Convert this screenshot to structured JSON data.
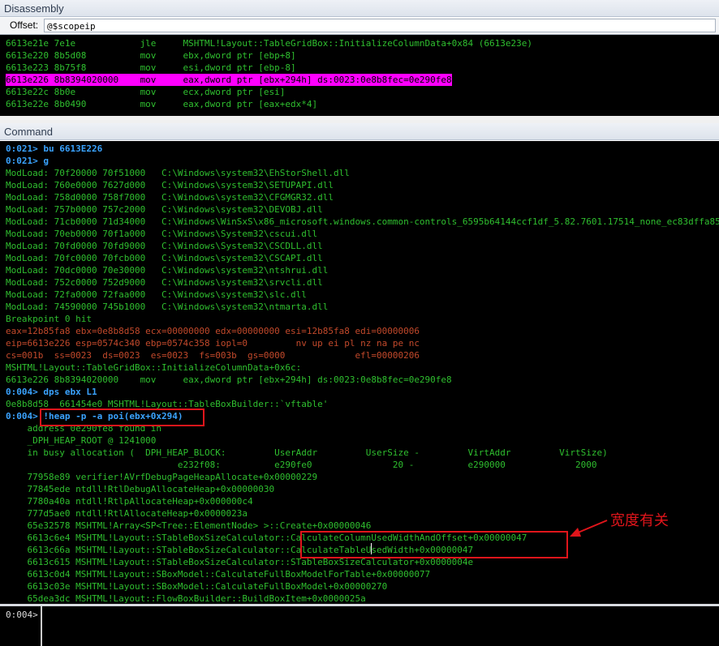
{
  "disassembly": {
    "title": "Disassembly",
    "offset_label": "Offset:",
    "offset_value": "@$scopeip",
    "lines": [
      "6613e21e 7e1e            jle     MSHTML!Layout::TableGridBox::InitializeColumnData+0x84 (6613e23e)",
      "6613e220 8b5d08          mov     ebx,dword ptr [ebp+8]",
      "6613e223 8b75f8          mov     esi,dword ptr [ebp-8]",
      "6613e226 8b8394020000    mov     eax,dword ptr [ebx+294h] ds:0023:0e8b8fec=0e290fe8",
      "6613e22c 8b0e            mov     ecx,dword ptr [esi]",
      "6613e22e 8b0490          mov     eax,dword ptr [eax+edx*4]"
    ],
    "highlighted_index": 3
  },
  "command": {
    "title": "Command",
    "lines": [
      {
        "t": "0:021> bu 6613E226",
        "c": "prompt"
      },
      {
        "t": "0:021> g",
        "c": "prompt"
      },
      {
        "t": "ModLoad: 70f20000 70f51000   C:\\Windows\\system32\\EhStorShell.dll",
        "c": "txt"
      },
      {
        "t": "ModLoad: 760e0000 7627d000   C:\\Windows\\system32\\SETUPAPI.dll",
        "c": "txt"
      },
      {
        "t": "ModLoad: 758d0000 758f7000   C:\\Windows\\system32\\CFGMGR32.dll",
        "c": "txt"
      },
      {
        "t": "ModLoad: 757b0000 757c2000   C:\\Windows\\system32\\DEVOBJ.dll",
        "c": "txt"
      },
      {
        "t": "ModLoad: 71cb0000 71d34000   C:\\Windows\\WinSxS\\x86_microsoft.windows.common-controls_6595b64144ccf1df_5.82.7601.17514_none_ec83dffa859149af",
        "c": "txt"
      },
      {
        "t": "ModLoad: 70eb0000 70f1a000   C:\\Windows\\System32\\cscui.dll",
        "c": "txt"
      },
      {
        "t": "ModLoad: 70fd0000 70fd9000   C:\\Windows\\System32\\CSCDLL.dll",
        "c": "txt"
      },
      {
        "t": "ModLoad: 70fc0000 70fcb000   C:\\Windows\\system32\\CSCAPI.dll",
        "c": "txt"
      },
      {
        "t": "ModLoad: 70dc0000 70e30000   C:\\Windows\\system32\\ntshrui.dll",
        "c": "txt"
      },
      {
        "t": "ModLoad: 752c0000 752d9000   C:\\Windows\\system32\\srvcli.dll",
        "c": "txt"
      },
      {
        "t": "ModLoad: 72fa0000 72faa000   C:\\Windows\\system32\\slc.dll",
        "c": "txt"
      },
      {
        "t": "ModLoad: 74590000 745b1000   C:\\Windows\\system32\\ntmarta.dll",
        "c": "txt"
      },
      {
        "t": "Breakpoint 0 hit",
        "c": "txt"
      },
      {
        "t": "eax=12b85fa8 ebx=0e8b8d58 ecx=00000000 edx=00000000 esi=12b85fa8 edi=00000006",
        "c": "err"
      },
      {
        "t": "eip=6613e226 esp=0574c340 ebp=0574c358 iopl=0         nv up ei pl nz na pe nc",
        "c": "err"
      },
      {
        "t": "cs=001b  ss=0023  ds=0023  es=0023  fs=003b  gs=0000             efl=00000206",
        "c": "err"
      },
      {
        "t": "MSHTML!Layout::TableGridBox::InitializeColumnData+0x6c:",
        "c": "txt"
      },
      {
        "t": "6613e226 8b8394020000    mov     eax,dword ptr [ebx+294h] ds:0023:0e8b8fec=0e290fe8",
        "c": "txt"
      },
      {
        "t": "0:004> dps ebx L1",
        "c": "prompt"
      },
      {
        "t": "0e8b8d58  661454e0 MSHTML!Layout::TableBoxBuilder::`vftable'",
        "c": "txt"
      },
      {
        "t": "0:004> !heap -p -a poi(ebx+0x294)",
        "c": "prompt"
      },
      {
        "t": "    address 0e290fe8 found in",
        "c": "txt"
      },
      {
        "t": "    _DPH_HEAP_ROOT @ 1241000",
        "c": "txt"
      },
      {
        "t": "    in busy allocation (  DPH_HEAP_BLOCK:         UserAddr         UserSize -         VirtAddr         VirtSize)",
        "c": "txt"
      },
      {
        "t": "                                e232f08:          e290fe0               20 -          e290000             2000",
        "c": "txt"
      },
      {
        "t": "    77958e89 verifier!AVrfDebugPageHeapAllocate+0x00000229",
        "c": "txt"
      },
      {
        "t": "    77845ede ntdll!RtlDebugAllocateHeap+0x00000030",
        "c": "txt"
      },
      {
        "t": "    7780a40a ntdll!RtlpAllocateHeap+0x000000c4",
        "c": "txt"
      },
      {
        "t": "    777d5ae0 ntdll!RtlAllocateHeap+0x0000023a",
        "c": "txt"
      },
      {
        "t": "    65e32578 MSHTML!Array<SP<Tree::ElementNode> >::Create+0x00000046",
        "c": "txt"
      },
      {
        "t": "    6613c6e4 MSHTML!Layout::STableBoxSizeCalculator::CalculateColumnUsedWidthAndOffset+0x00000047",
        "c": "txt"
      },
      {
        "t": "    6613c66a MSHTML!Layout::STableBoxSizeCalculator::CalculateTableUsedWidth+0x00000047",
        "c": "txt"
      },
      {
        "t": "    6613c615 MSHTML!Layout::STableBoxSizeCalculator::STableBoxSizeCalculator+0x0000004e",
        "c": "txt"
      },
      {
        "t": "    6613c0d4 MSHTML!Layout::SBoxModel::CalculateFullBoxModelForTable+0x00000077",
        "c": "txt"
      },
      {
        "t": "    6613c03e MSHTML!Layout::SBoxModel::CalculateFullBoxModel+0x00000270",
        "c": "txt"
      },
      {
        "t": "    65dea3dc MSHTML!Layout::FlowBoxBuilder::BuildBoxItem+0x0000025a",
        "c": "txt"
      }
    ]
  },
  "input": {
    "prompt": "0:004>"
  },
  "annotation": {
    "text": "宽度有关"
  },
  "colors": {
    "text_green": "#2fbf2f",
    "prompt_blue": "#3aa3ff",
    "register_red": "#c2492b",
    "highlight": "#ff00ff",
    "annotation_red": "#e0151b"
  }
}
